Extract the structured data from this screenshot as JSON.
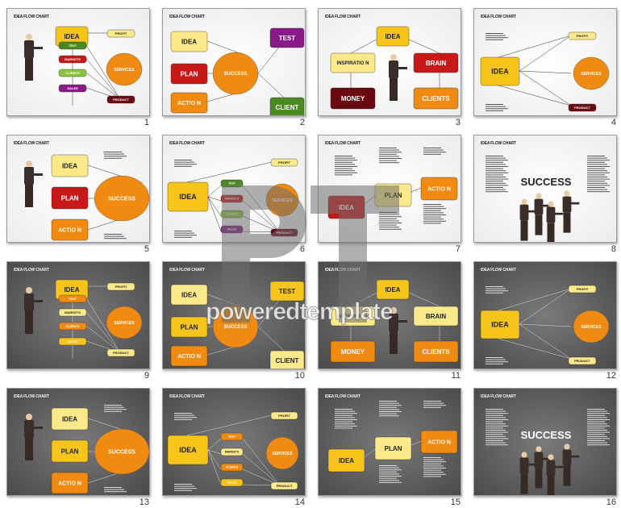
{
  "gallery": {
    "watermark": "poweredtemplate",
    "watermark_logo": "pt-logo",
    "slide_title": "IDEA FLOW CHART",
    "colors": {
      "light_bg": "#efefef",
      "dark_bg": "#5a5a5a",
      "orange": "#f08a10",
      "yellow": "#f7c51a",
      "pale_yellow": "#fbe98a",
      "red": "#c81818",
      "green": "#4a8a20",
      "lime": "#8cc43c",
      "purple": "#8a1a88",
      "maroon": "#6a0a10"
    },
    "slides": [
      {
        "number": "1",
        "theme": "light",
        "layout": "chain",
        "nodes": [
          "IDEA",
          "TEST",
          "MARKETS",
          "CLIENTS",
          "SALES",
          "PROFIT",
          "SERVICES",
          "PRODUCT"
        ]
      },
      {
        "number": "2",
        "theme": "light",
        "layout": "hub",
        "nodes": [
          "IDEA",
          "PLAN",
          "ACTIO N",
          "SUCCESS",
          "TEST",
          "CLIENT"
        ]
      },
      {
        "number": "3",
        "theme": "light",
        "layout": "tree",
        "nodes": [
          "IDEA",
          "INSPIRATIO N",
          "BRAIN",
          "MONEY",
          "CLIENTS"
        ]
      },
      {
        "number": "4",
        "theme": "light",
        "layout": "simple",
        "nodes": [
          "IDEA",
          "PROFIT",
          "SERVICES",
          "PRODUCT"
        ]
      },
      {
        "number": "5",
        "theme": "light",
        "layout": "three",
        "nodes": [
          "IDEA",
          "PLAN",
          "ACTIO N",
          "SUCCESS"
        ]
      },
      {
        "number": "6",
        "theme": "light",
        "layout": "full",
        "nodes": [
          "IDEA",
          "TEST",
          "MARKETS",
          "CLIENTS",
          "SALES",
          "PROFIT",
          "SERVICES",
          "PRODUCT"
        ]
      },
      {
        "number": "7",
        "theme": "light",
        "layout": "steps",
        "nodes": [
          "IDEA",
          "PLAN",
          "ACTIO N"
        ]
      },
      {
        "number": "8",
        "theme": "light",
        "layout": "team",
        "nodes": [
          "SUCCESS"
        ]
      },
      {
        "number": "9",
        "theme": "dark",
        "layout": "chain",
        "nodes": [
          "IDEA",
          "TEST",
          "MARKETS",
          "CLIENTS",
          "SALES",
          "PROFIT",
          "SERVICES",
          "PRODUCT"
        ]
      },
      {
        "number": "10",
        "theme": "dark",
        "layout": "hub",
        "nodes": [
          "IDEA",
          "PLAN",
          "ACTIO N",
          "SUCCESS",
          "TEST",
          "CLIENT"
        ]
      },
      {
        "number": "11",
        "theme": "dark",
        "layout": "tree",
        "nodes": [
          "IDEA",
          "INSPIRATIO N",
          "BRAIN",
          "MONEY",
          "CLIENTS"
        ]
      },
      {
        "number": "12",
        "theme": "dark",
        "layout": "simple",
        "nodes": [
          "IDEA",
          "PROFIT",
          "SERVICES",
          "PRODUCT"
        ]
      },
      {
        "number": "13",
        "theme": "dark",
        "layout": "three",
        "nodes": [
          "IDEA",
          "PLAN",
          "ACTIO N",
          "SUCCESS"
        ]
      },
      {
        "number": "14",
        "theme": "dark",
        "layout": "full",
        "nodes": [
          "IDEA",
          "TEST",
          "MARKETS",
          "CLIENTS",
          "SALES",
          "PROFIT",
          "SERVICES",
          "PRODUCT"
        ]
      },
      {
        "number": "15",
        "theme": "dark",
        "layout": "steps",
        "nodes": [
          "IDEA",
          "PLAN",
          "ACTIO N"
        ]
      },
      {
        "number": "16",
        "theme": "dark",
        "layout": "team",
        "nodes": [
          "SUCCESS"
        ]
      }
    ]
  }
}
